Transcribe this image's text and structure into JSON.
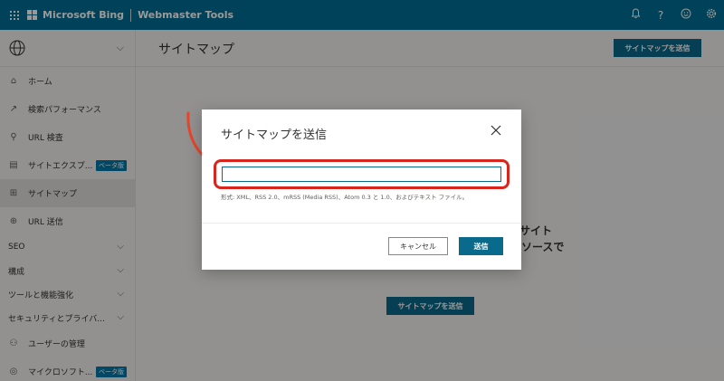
{
  "topbar": {
    "brand": "Microsoft Bing",
    "product": "Webmaster Tools",
    "icons": [
      "waffle-icon",
      "bell-icon",
      "help-icon",
      "smiley-icon",
      "gear-icon"
    ],
    "help_glyph": "?"
  },
  "sidebar": {
    "items": [
      {
        "label": "ホーム",
        "icon": "home-icon"
      },
      {
        "label": "検索パフォーマンス",
        "icon": "trend-icon"
      },
      {
        "label": "URL 検査",
        "icon": "search-icon"
      },
      {
        "label": "サイトエクスプ...",
        "icon": "document-icon",
        "badge": "ベータ版"
      },
      {
        "label": "サイトマップ",
        "icon": "sitemap-icon",
        "active": true
      },
      {
        "label": "URL 送信",
        "icon": "globe-icon"
      }
    ],
    "sections": [
      "SEO",
      "構成",
      "ツールと機能強化",
      "セキュリティとプライバ..."
    ],
    "bottom_items": [
      {
        "label": "ユーザーの管理",
        "icon": "users-icon"
      },
      {
        "label": "マイクロソフト...",
        "icon": "shield-icon",
        "badge": "ベータ版"
      }
    ]
  },
  "main": {
    "title": "サイトマップ",
    "header_button": "サイトマップを送信",
    "background_text_1": "。サイト",
    "background_text_2": "ソースで",
    "center_button": "サイトマップを送信"
  },
  "dialog": {
    "title": "サイトマップを送信",
    "input_value": "",
    "hint": "形式: XML、RSS 2.0、mRSS (Media RSS)、Atom 0.3 と 1.0、およびテキスト ファイル。",
    "cancel_label": "キャンセル",
    "send_label": "送信"
  },
  "colors": {
    "brand": "#006f94",
    "primary_button": "#0a6a8c",
    "highlight": "#d9261c"
  }
}
